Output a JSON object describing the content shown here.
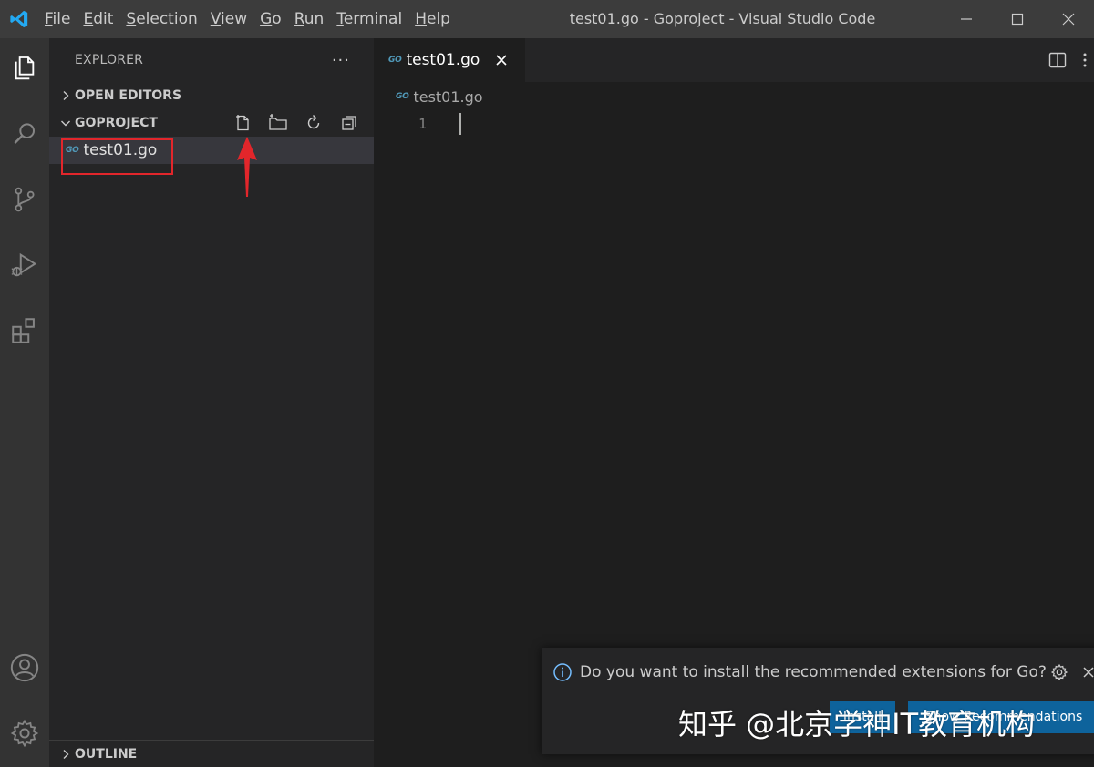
{
  "titlebar": {
    "menu": [
      {
        "label": "File",
        "mnemonic": "F",
        "rest": "ile"
      },
      {
        "label": "Edit",
        "mnemonic": "E",
        "rest": "dit"
      },
      {
        "label": "Selection",
        "mnemonic": "S",
        "rest": "election"
      },
      {
        "label": "View",
        "mnemonic": "V",
        "rest": "iew"
      },
      {
        "label": "Go",
        "mnemonic": "G",
        "rest": "o"
      },
      {
        "label": "Run",
        "mnemonic": "R",
        "rest": "un"
      },
      {
        "label": "Terminal",
        "mnemonic": "T",
        "rest": "erminal"
      },
      {
        "label": "Help",
        "mnemonic": "H",
        "rest": "elp"
      }
    ],
    "title": "test01.go - Goproject - Visual Studio Code"
  },
  "sidebar": {
    "header": "EXPLORER",
    "more": "···",
    "open_editors": "OPEN EDITORS",
    "project": "GOPROJECT",
    "file_icon": "GO",
    "file": "test01.go",
    "outline": "OUTLINE"
  },
  "editor": {
    "tab_icon": "GO",
    "tab": "test01.go",
    "breadcrumb_icon": "GO",
    "breadcrumb": "test01.go",
    "line_number": "1"
  },
  "notification": {
    "message": "Do you want to install the recommended extensions for Go?",
    "install": "Install",
    "show": "Show Recommendations"
  },
  "watermark": "知乎 @北京学神IT教育机构",
  "colors": {
    "accent": "#0e639c",
    "go_blue": "#519aba",
    "annotation_red": "#e2262b"
  }
}
